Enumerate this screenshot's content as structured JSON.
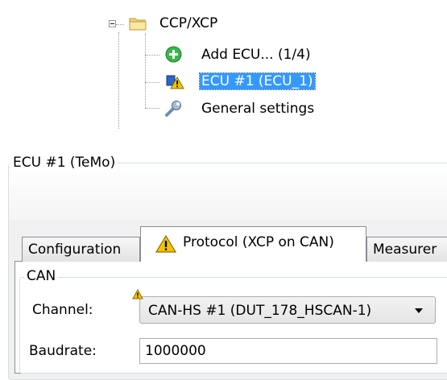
{
  "tree": {
    "root_label": "CCP/XCP",
    "items": [
      {
        "label": "Add ECU... (1/4)",
        "icon": "add-icon"
      },
      {
        "label": "ECU #1 (ECU_1)",
        "icon": "ecu-warning-icon",
        "selected": true
      },
      {
        "label": "General settings",
        "icon": "wrench-icon"
      }
    ]
  },
  "panel": {
    "title": "ECU #1 (TeMo)",
    "tabs": [
      {
        "label": "Configuration"
      },
      {
        "label": "Protocol (XCP on CAN)",
        "icon": "warning-icon",
        "active": true
      },
      {
        "label": "Measurer"
      }
    ],
    "can_group": {
      "title": "CAN",
      "channel_label": "Channel:",
      "channel_value": "CAN-HS #1 (DUT_178_HSCAN-1)",
      "baudrate_label": "Baudrate:",
      "baudrate_value": "1000000"
    }
  },
  "colors": {
    "selection": "#3399ff",
    "warning": "#f5c400",
    "add_green": "#2eaa3c"
  }
}
